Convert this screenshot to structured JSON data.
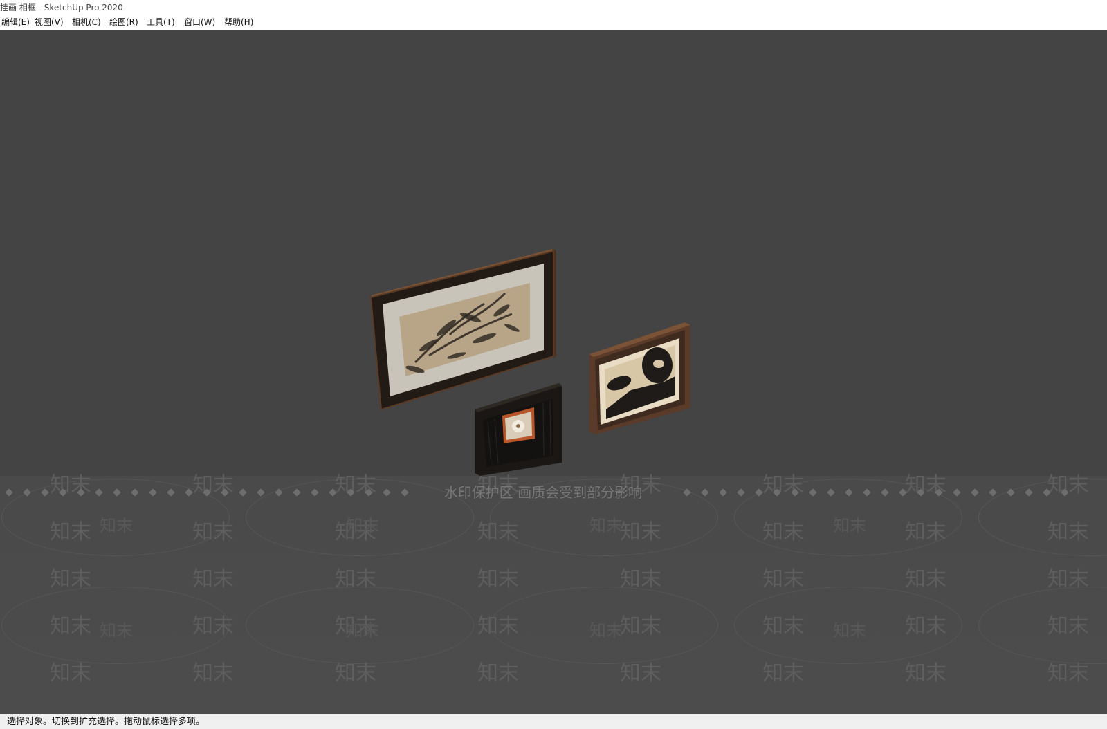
{
  "window": {
    "title": "挂画 相框 - SketchUp Pro 2020"
  },
  "menu": {
    "items": [
      {
        "label": "编辑(E)"
      },
      {
        "label": "视图(V)"
      },
      {
        "label": "相机(C)"
      },
      {
        "label": "绘图(R)"
      },
      {
        "label": "工具(T)"
      },
      {
        "label": "窗口(W)"
      },
      {
        "label": "帮助(H)"
      }
    ]
  },
  "viewport": {
    "background_color": "#444444",
    "watermark": {
      "notice": "水印保护区  画质会受到部分影响",
      "brand": "知末"
    }
  },
  "status": {
    "text": "选择对象。切换到扩充选择。拖动鼠标选择多项。"
  }
}
